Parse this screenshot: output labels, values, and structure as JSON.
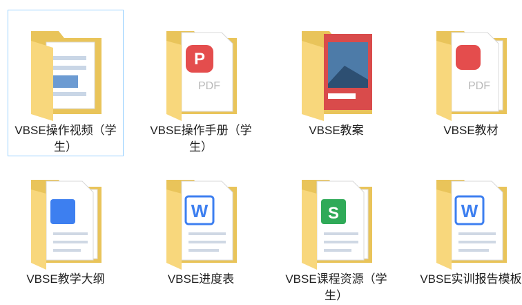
{
  "files": [
    {
      "label": "VBSE操作视频（学生）",
      "icon": "folder-doc-icon",
      "selected": true
    },
    {
      "label": "VBSE操作手册（学生）",
      "icon": "folder-pdf-icon",
      "selected": false
    },
    {
      "label": "VBSE教案",
      "icon": "folder-image-icon",
      "selected": false
    },
    {
      "label": "VBSE教材",
      "icon": "folder-pdf-icon",
      "selected": false
    },
    {
      "label": "VBSE教学大纲",
      "icon": "folder-word-icon",
      "selected": false
    },
    {
      "label": "VBSE进度表",
      "icon": "folder-word-icon",
      "selected": false
    },
    {
      "label": "VBSE课程资源（学生）",
      "icon": "folder-excel-icon",
      "selected": false
    },
    {
      "label": "VBSE实训报告模板",
      "icon": "folder-word-icon",
      "selected": false
    }
  ],
  "badges": {
    "pdf_text": "PDF",
    "word_letter": "W",
    "excel_letter": "S",
    "wps_letter": "P"
  },
  "colors": {
    "folder_back": "#e9c45a",
    "folder_front": "#f8d77c",
    "selection_border": "#99d1ff",
    "pdf_red": "#e44d4d",
    "word_blue": "#3d7ff0",
    "excel_green": "#2faa58"
  }
}
